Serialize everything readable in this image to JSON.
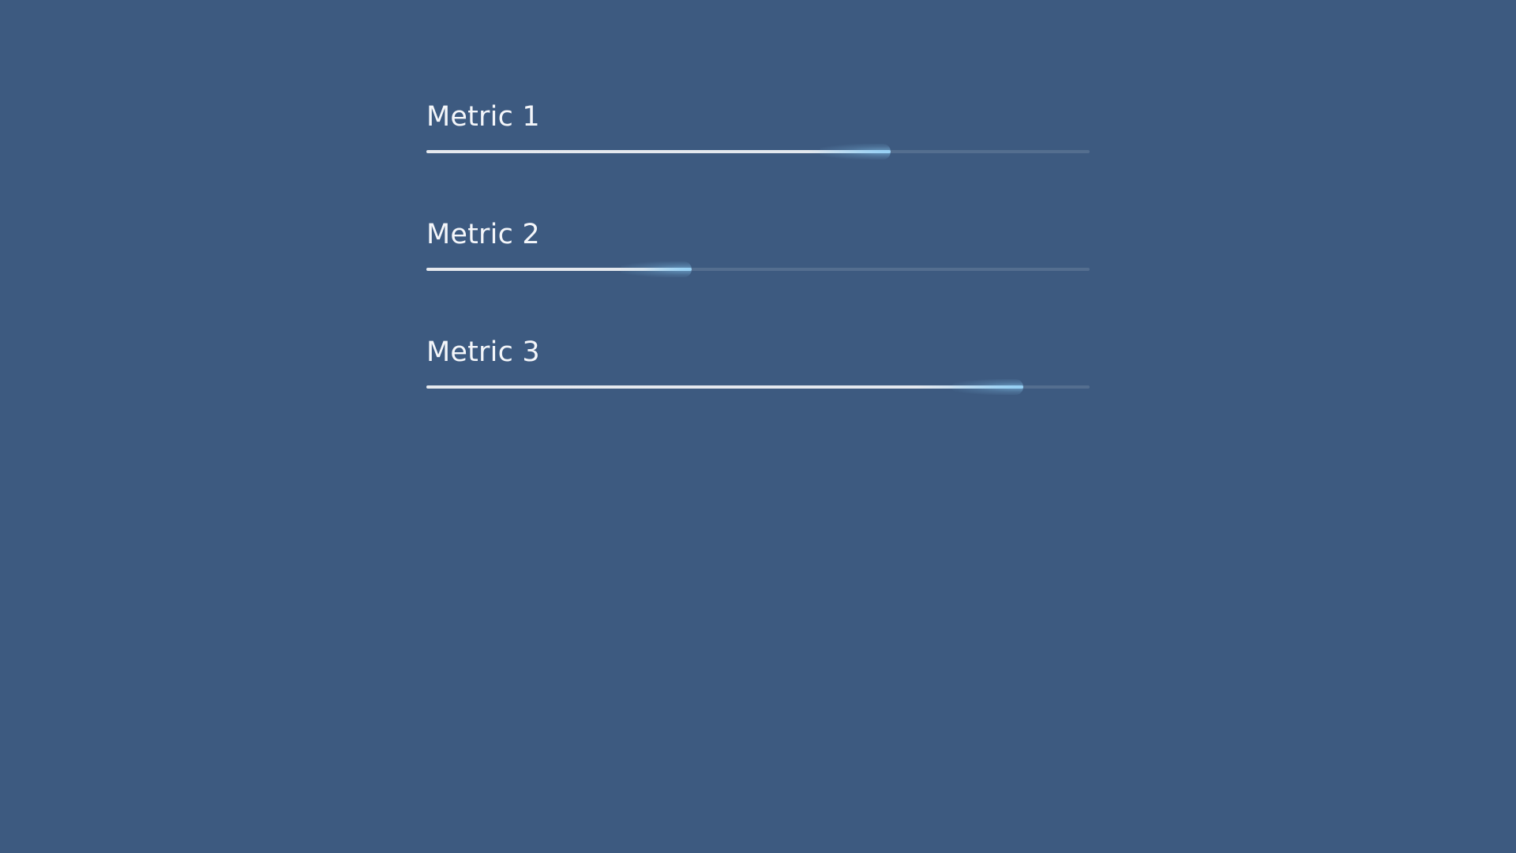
{
  "colors": {
    "background": "#3d5a80",
    "label": "#f4f6fa",
    "bar_fill": "#e6e9ee",
    "bar_glow": "#9fd2f4",
    "track": "#5a7597"
  },
  "metrics": [
    {
      "label": "Metric 1",
      "progress": 0.7
    },
    {
      "label": "Metric 2",
      "progress": 0.4
    },
    {
      "label": "Metric 3",
      "progress": 0.9
    }
  ]
}
